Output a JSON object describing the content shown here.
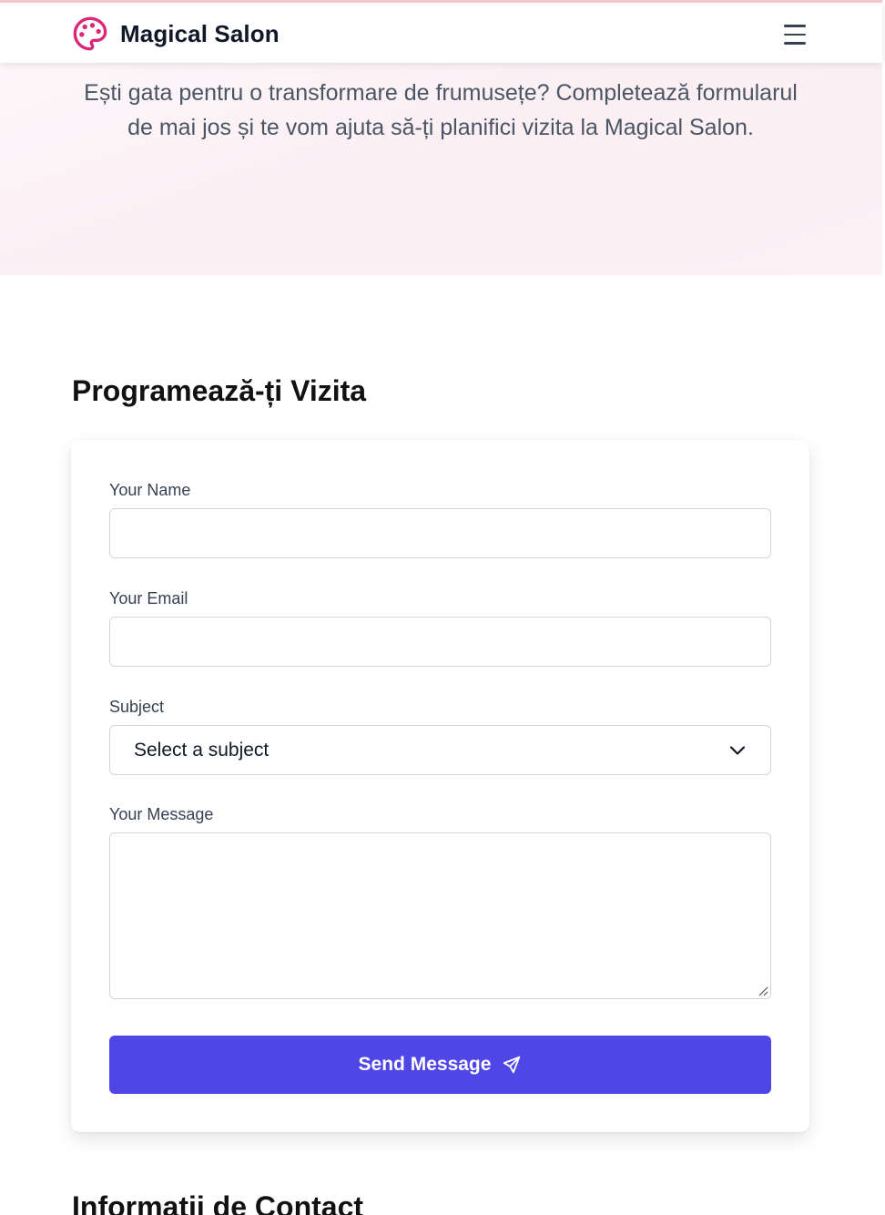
{
  "header": {
    "brand_name": "Magical Salon",
    "logo_icon": "palette-icon",
    "menu_icon": "hamburger-menu-icon",
    "accent_color": "#db2777"
  },
  "hero": {
    "intro_text": "Ești gata pentru o transformare de frumusețe? Completează formularul de mai jos și te vom ajuta să-ți planifici vizita la Magical Salon."
  },
  "booking": {
    "title": "Programează-ți Vizita",
    "form": {
      "name_label": "Your Name",
      "name_value": "",
      "email_label": "Your Email",
      "email_value": "",
      "subject_label": "Subject",
      "subject_selected": "Select a subject",
      "message_label": "Your Message",
      "message_value": "",
      "submit_label": "Send Message",
      "submit_icon": "send-icon",
      "submit_color": "#4f46e5"
    }
  },
  "contact": {
    "title": "Informații de Contact"
  }
}
